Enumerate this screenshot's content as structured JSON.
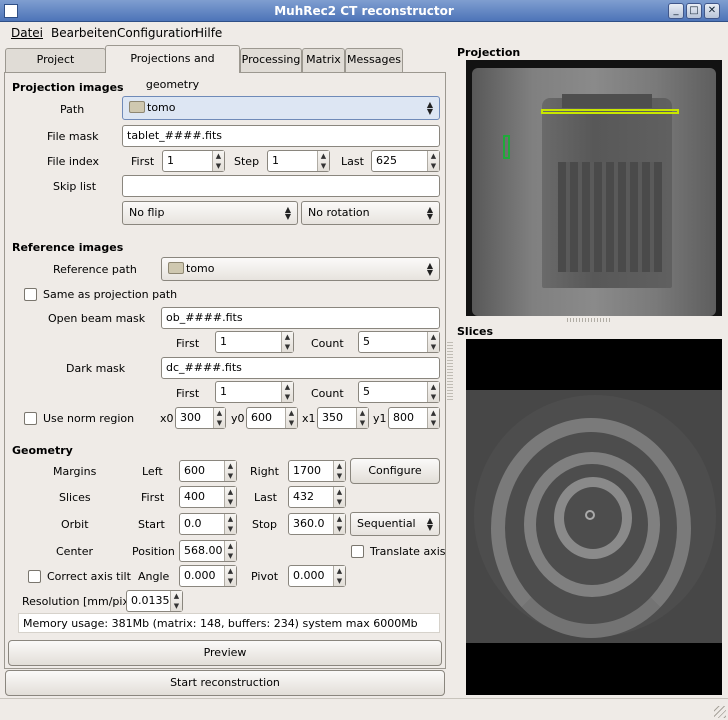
{
  "window": {
    "title": "MuhRec2 CT reconstructor"
  },
  "menu": [
    "Datei",
    "Bearbeiten",
    "Configuration",
    "Hilfe"
  ],
  "tabs": [
    "Project information",
    "Projections and geometry",
    "Processing",
    "Matrix",
    "Messages"
  ],
  "proj": {
    "heading": "Projection images",
    "path_label": "Path",
    "path_value": "tomo",
    "filemask_label": "File mask",
    "filemask_value": "tablet_####.fits",
    "fileindex_label": "File index",
    "first_label": "First",
    "first_value": "1",
    "step_label": "Step",
    "step_value": "1",
    "last_label": "Last",
    "last_value": "625",
    "skiplist_label": "Skip list",
    "skiplist_value": "",
    "flip_value": "No flip",
    "rotation_value": "No rotation"
  },
  "ref": {
    "heading": "Reference images",
    "refpath_label": "Reference path",
    "refpath_value": "tomo",
    "same_label": "Same as projection path",
    "openbeam_label": "Open beam mask",
    "openbeam_value": "ob_####.fits",
    "ob_first_label": "First",
    "ob_first_value": "1",
    "ob_count_label": "Count",
    "ob_count_value": "5",
    "dark_label": "Dark mask",
    "dark_value": "dc_####.fits",
    "dc_first_label": "First",
    "dc_first_value": "1",
    "dc_count_label": "Count",
    "dc_count_value": "5",
    "norm_label": "Use norm region",
    "x0_label": "x0",
    "x0_value": "300",
    "y0_label": "y0",
    "y0_value": "600",
    "x1_label": "x1",
    "x1_value": "350",
    "y1_label": "y1",
    "y1_value": "800"
  },
  "geo": {
    "heading": "Geometry",
    "margins_label": "Margins",
    "left_label": "Left",
    "left_value": "600",
    "right_label": "Right",
    "right_value": "1700",
    "configure_label": "Configure",
    "slices_label": "Slices",
    "sfirst_label": "First",
    "sfirst_value": "400",
    "slast_label": "Last",
    "slast_value": "432",
    "orbit_label": "Orbit",
    "start_label": "Start",
    "start_value": "0.0",
    "stop_label": "Stop",
    "stop_value": "360.0",
    "orbit_mode": "Sequential",
    "center_label": "Center",
    "position_label": "Position",
    "position_value": "568.00",
    "translate_label": "Translate axis",
    "tilt_label": "Correct axis tilt",
    "angle_label": "Angle",
    "angle_value": "0.000",
    "pivot_label": "Pivot",
    "pivot_value": "0.000",
    "resolution_label": "Resolution [mm/pixel]",
    "resolution_value": "0.0135",
    "memory": "Memory usage: 381Mb (matrix: 148, buffers: 234) system max 6000Mb"
  },
  "buttons": {
    "preview": "Preview",
    "start": "Start reconstruction"
  },
  "right": {
    "projection_title": "Projection",
    "slices_title": "Slices"
  }
}
